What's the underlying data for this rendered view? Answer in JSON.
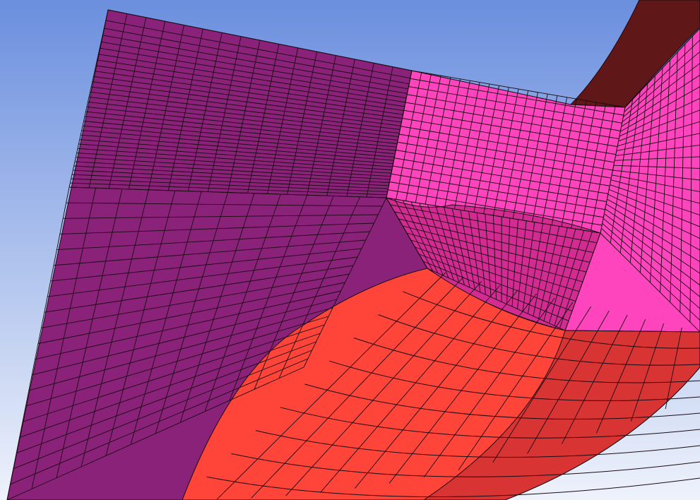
{
  "viewport": {
    "background_top": "#6b8fde",
    "background_bottom": "#eef2fb"
  },
  "parts": [
    {
      "id": "outer-block-face",
      "color": "#8a2279"
    },
    {
      "id": "fillet-top-face",
      "color": "#ff45be"
    },
    {
      "id": "fillet-side-face",
      "color": "#d22c92"
    },
    {
      "id": "inner-bore-face",
      "color": "#ff4539"
    },
    {
      "id": "inner-bore-shaded-face",
      "color": "#d83434"
    },
    {
      "id": "flange-rim-face",
      "color": "#601717"
    }
  ],
  "mesh": {
    "edge_color": "#1a0a12"
  }
}
